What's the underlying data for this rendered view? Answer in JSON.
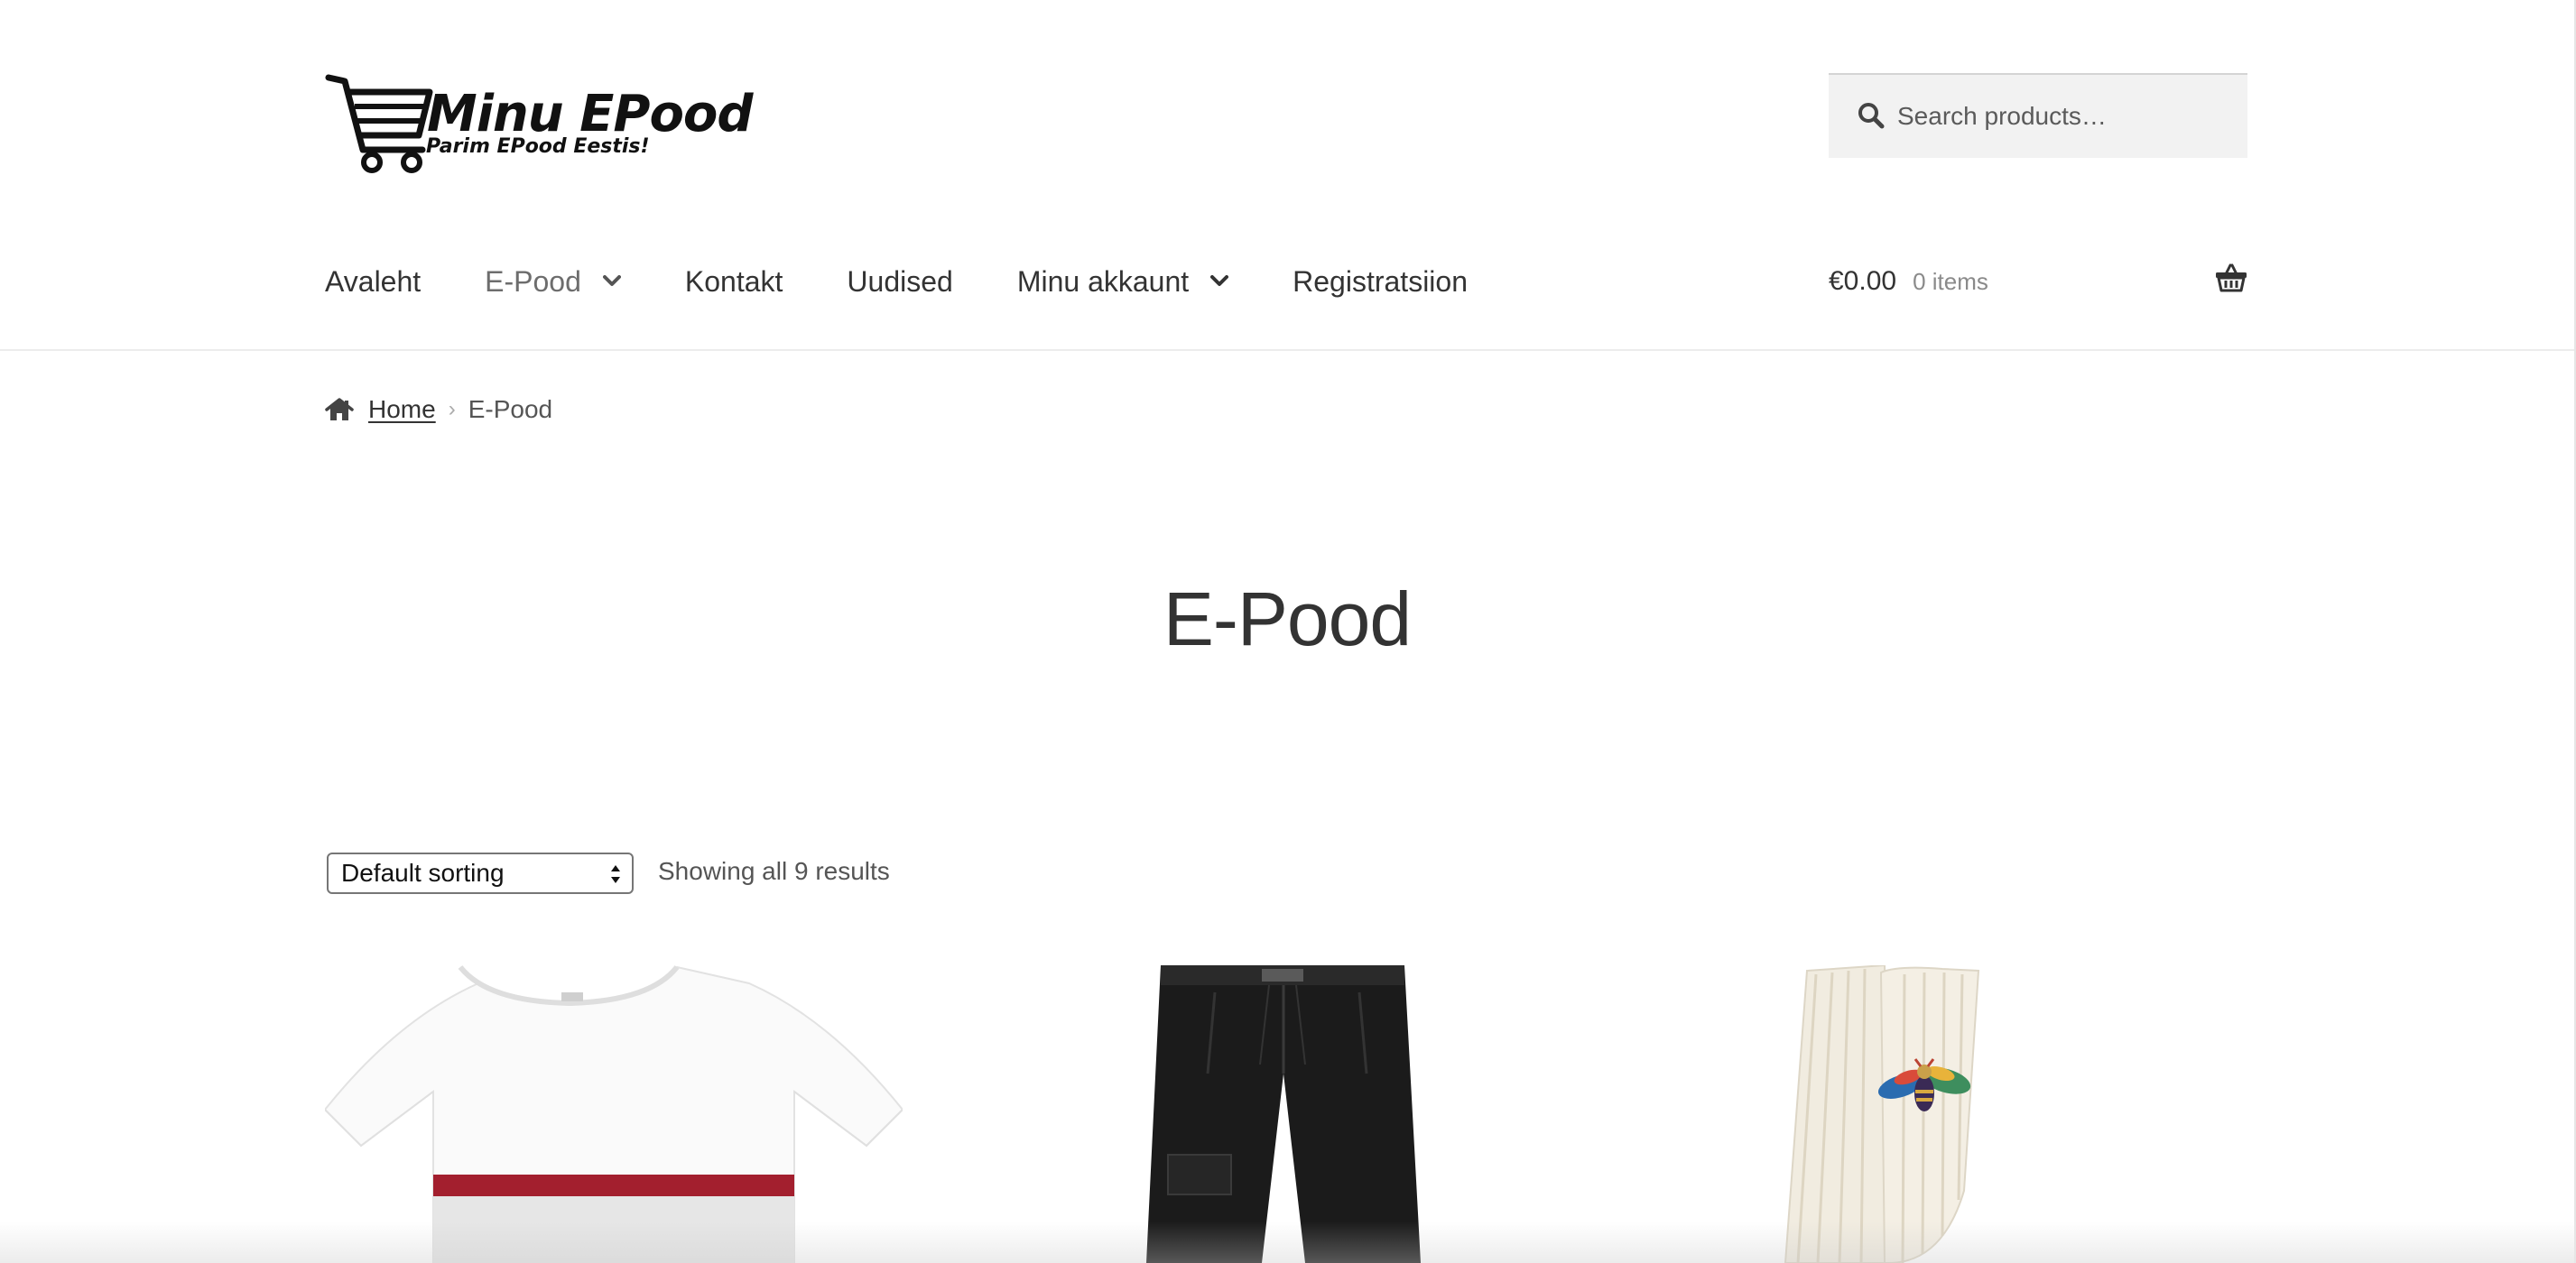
{
  "header": {
    "logo": {
      "title": "Minu EPood",
      "tagline": "Parim EPood Eestis!",
      "icon": "shopping-cart-icon"
    },
    "search": {
      "placeholder": "Search products…",
      "icon": "search-icon"
    },
    "nav": {
      "items": [
        {
          "label": "Avaleht",
          "has_dropdown": false
        },
        {
          "label": "E-Pood",
          "has_dropdown": true,
          "active": true
        },
        {
          "label": "Kontakt",
          "has_dropdown": false
        },
        {
          "label": "Uudised",
          "has_dropdown": false
        },
        {
          "label": "Minu akkaunt",
          "has_dropdown": true
        },
        {
          "label": "Registratsiion",
          "has_dropdown": false
        }
      ]
    },
    "cart": {
      "amount": "€0.00",
      "count": "0 items",
      "icon": "basket-icon"
    }
  },
  "breadcrumb": {
    "home_label": "Home",
    "separator": "›",
    "current": "E-Pood",
    "icon": "home-icon"
  },
  "page_title": "E-Pood",
  "toolbar": {
    "sort_selected": "Default sorting",
    "result_count": "Showing all 9 results"
  },
  "products": [
    {
      "image": "white-tshirt-red-stripe"
    },
    {
      "image": "black-cargo-trousers"
    },
    {
      "image": "cream-knit-socks-bee"
    }
  ],
  "colors": {
    "text": "#333333",
    "muted": "#6d6d6d",
    "search_bg": "#f2f2f2",
    "stripe_red": "#a31f2e"
  }
}
